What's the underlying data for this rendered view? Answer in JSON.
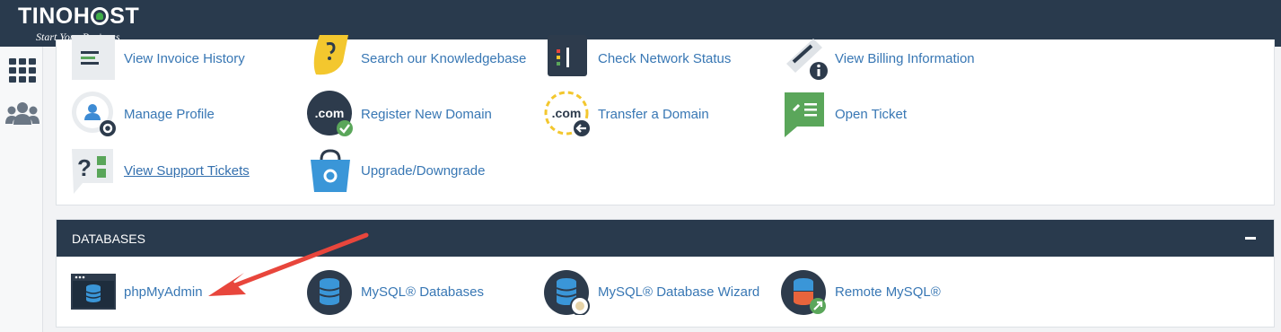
{
  "brand": {
    "name_part1": "TINOH",
    "name_part2": "ST",
    "tagline": "Start Your Business"
  },
  "rail": {
    "icons": [
      "grid-icon",
      "users-icon"
    ]
  },
  "top_items": [
    {
      "label": "View Invoice History"
    },
    {
      "label": "Search our Knowledgebase"
    },
    {
      "label": "Check Network Status"
    },
    {
      "label": "View Billing Information"
    },
    {
      "label": "Manage Profile"
    },
    {
      "label": "Register New Domain"
    },
    {
      "label": "Transfer a Domain"
    },
    {
      "label": "Open Ticket"
    },
    {
      "label": "View Support Tickets"
    },
    {
      "label": "Upgrade/Downgrade"
    }
  ],
  "databases": {
    "title": "DATABASES",
    "items": [
      {
        "label": "phpMyAdmin"
      },
      {
        "label": "MySQL® Databases"
      },
      {
        "label": "MySQL® Database Wizard"
      },
      {
        "label": "Remote MySQL®"
      }
    ]
  },
  "colors": {
    "header": "#293a4d",
    "link": "#3877b4",
    "arrow": "#e8463c"
  }
}
